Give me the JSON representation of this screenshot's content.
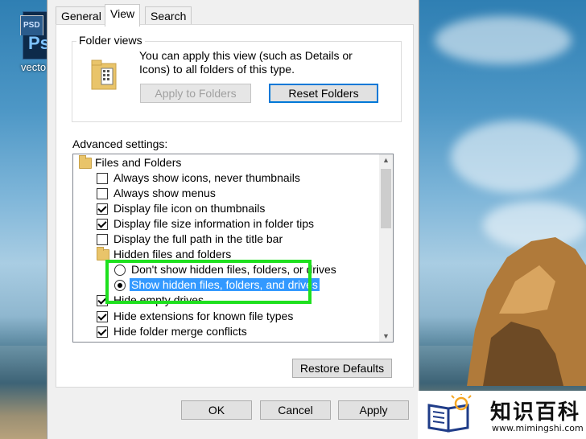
{
  "desktop": {
    "icon_badge": "PSD",
    "icon_symbol": "Ps",
    "icon_caption": "vecto"
  },
  "dialog": {
    "tabs": [
      {
        "label": "General",
        "active": false
      },
      {
        "label": "View",
        "active": true
      },
      {
        "label": "Search",
        "active": false
      }
    ],
    "folder_views": {
      "title": "Folder views",
      "description": "You can apply this view (such as Details or Icons) to all folders of this type.",
      "apply_button": "Apply to Folders",
      "reset_button": "Reset Folders"
    },
    "advanced_label": "Advanced settings:",
    "tree": {
      "items": [
        {
          "type": "folder",
          "label": "Files and Folders"
        },
        {
          "type": "checkbox",
          "label": "Always show icons, never thumbnails",
          "checked": false
        },
        {
          "type": "checkbox",
          "label": "Always show menus",
          "checked": false
        },
        {
          "type": "checkbox",
          "label": "Display file icon on thumbnails",
          "checked": true
        },
        {
          "type": "checkbox",
          "label": "Display file size information in folder tips",
          "checked": true
        },
        {
          "type": "checkbox",
          "label": "Display the full path in the title bar",
          "checked": false
        },
        {
          "type": "folder",
          "label": "Hidden files and folders"
        },
        {
          "type": "radio",
          "label": "Don't show hidden files, folders, or drives",
          "checked": false
        },
        {
          "type": "radio",
          "label": "Show hidden files, folders, and drives",
          "checked": true,
          "selected": true
        },
        {
          "type": "checkbox",
          "label": "Hide empty drives",
          "checked": true
        },
        {
          "type": "checkbox",
          "label": "Hide extensions for known file types",
          "checked": true
        },
        {
          "type": "checkbox",
          "label": "Hide folder merge conflicts",
          "checked": true
        }
      ]
    },
    "restore_button": "Restore Defaults",
    "ok_button": "OK",
    "cancel_button": "Cancel",
    "apply_button": "Apply"
  },
  "colors": {
    "highlight_box": "#1ee01e",
    "selection": "#3399ff",
    "focus_border": "#0078d7"
  },
  "watermark": {
    "title": "知识百科",
    "url": "www.mimingshi.com"
  }
}
